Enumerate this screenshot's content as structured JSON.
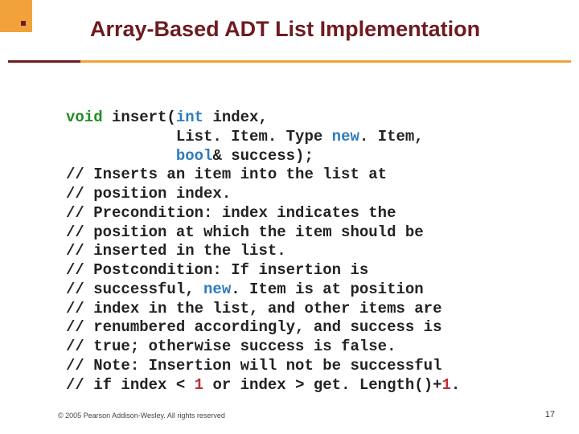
{
  "title": "Array-Based ADT List Implementation",
  "code": {
    "kw_void": "void",
    "fn_name": " insert(",
    "kw_int": "int",
    "p_index": " index,",
    "indent": "            ",
    "p_item_type": "List. Item. Type ",
    "kw_newItem": "new",
    "p_item_after": ". Item,",
    "kw_bool": "bool",
    "p_success": "& success);",
    "c01": "// Inserts an item into the list at",
    "c02": "// position index.",
    "c03": "// Precondition: index indicates the",
    "c04": "// position at which the item should be",
    "c05": "// inserted in the list.",
    "c06": "// Postcondition: If insertion is",
    "c07a": "// successful, ",
    "kw_newItem2": "new",
    "c07b": ". Item is at position",
    "c08": "// index in the list, and other items are",
    "c09": "// renumbered accordingly, and success is",
    "c10": "// true; otherwise success is false.",
    "c11": "// Note: Insertion will not be successful",
    "c12a": "// if index < ",
    "num1": "1",
    "c12b": " or index > get. Length()+",
    "num1b": "1",
    "c12c": "."
  },
  "footer": "© 2005 Pearson Addison-Wesley. All rights reserved",
  "page": "17"
}
